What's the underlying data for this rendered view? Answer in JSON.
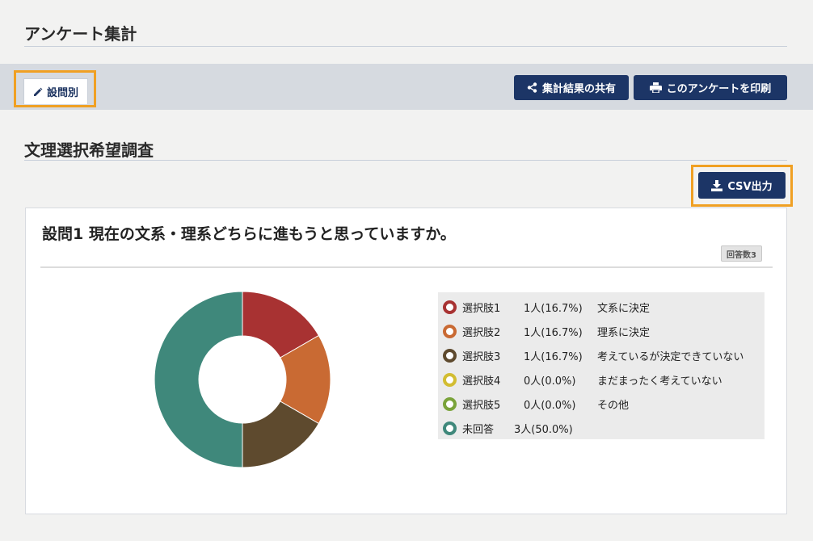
{
  "header": {
    "title": "アンケート集計"
  },
  "toolbar": {
    "tab_label": "設問別",
    "share_label": "集計結果の共有",
    "print_label": "このアンケートを印刷"
  },
  "survey": {
    "title": "文理選択希望調査",
    "csv_label": "CSV出力"
  },
  "question": {
    "title": "設問1  現在の文系・理系どちらに進もうと思っていますか。",
    "response_badge": "回答数3"
  },
  "legend": [
    {
      "label": "選択肢1",
      "count": "1人(16.7%)",
      "text": "文系に決定"
    },
    {
      "label": "選択肢2",
      "count": "1人(16.7%)",
      "text": "理系に決定"
    },
    {
      "label": "選択肢3",
      "count": "1人(16.7%)",
      "text": "考えているが決定できていない"
    },
    {
      "label": "選択肢4",
      "count": "0人(0.0%)",
      "text": "まだまったく考えていない"
    },
    {
      "label": "選択肢5",
      "count": "0人(0.0%)",
      "text": "その他"
    },
    {
      "label": "未回答",
      "count": "3人(50.0%)",
      "text": ""
    }
  ],
  "chart_data": {
    "type": "pie",
    "categories": [
      "選択肢1",
      "選択肢2",
      "選択肢3",
      "選択肢4",
      "選択肢5",
      "未回答"
    ],
    "values": [
      1,
      1,
      1,
      0,
      0,
      3
    ],
    "colors": [
      "#a83232",
      "#c96a33",
      "#5e4a2e",
      "#d2bd32",
      "#7aa33a",
      "#3f887b"
    ],
    "donut": true
  },
  "icons": {
    "tab": "pencil-icon",
    "share": "share-icon",
    "print": "printer-icon",
    "csv": "download-icon"
  }
}
